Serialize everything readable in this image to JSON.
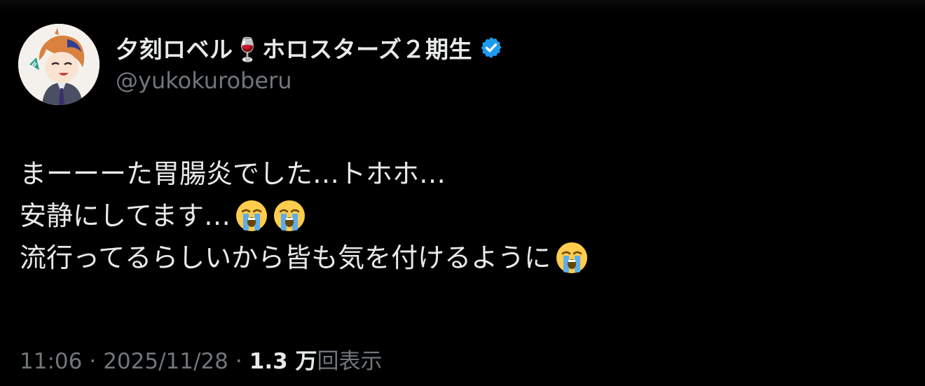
{
  "author": {
    "display_name": "夕刻ロベル🍷ホロスターズ２期生",
    "handle": "@yukokuroberu",
    "verified": true,
    "verified_color": "#1d9bf0"
  },
  "tweet": {
    "lines": [
      {
        "text": "まーーーた胃腸炎でした…トホホ…",
        "emojis": []
      },
      {
        "text": "安静にしてます…",
        "emojis": [
          "loudly-crying-face-icon",
          "loudly-crying-face-icon"
        ]
      },
      {
        "text": "流行ってるらしいから皆も気を付けるように",
        "emojis": [
          "loudly-crying-face-icon"
        ]
      }
    ]
  },
  "meta": {
    "time": "11:06",
    "separator": "·",
    "date": "2025/11/28",
    "views_count": "1.3 万",
    "views_label": "回表示"
  },
  "colors": {
    "background": "#000000",
    "text_primary": "#e7e9ea",
    "text_secondary": "#71767b"
  }
}
